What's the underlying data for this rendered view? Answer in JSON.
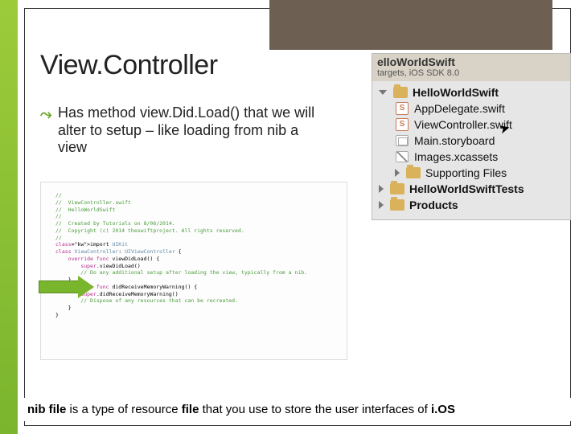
{
  "title": "View.Controller",
  "bullet": {
    "glyph": "⤳",
    "text": "Has method view.Did.Load() that we will alter to setup – like loading from nib a view"
  },
  "code": {
    "lines": [
      "//",
      "//  ViewController.swift",
      "//  HelloWorldSwift",
      "//",
      "//  Created by Tutorials on 8/06/2014.",
      "//  Copyright (c) 2014 theswiftproject. All rights reserved.",
      "//",
      "",
      "import UIKit",
      "",
      "class ViewController: UIViewController {",
      "",
      "    override func viewDidLoad() {",
      "        super.viewDidLoad()",
      "        // Do any additional setup after loading the view, typically from a nib.",
      "    }",
      "",
      "    override func didReceiveMemoryWarning() {",
      "        super.didReceiveMemoryWarning()",
      "        // Dispose of any resources that can be recreated.",
      "    }",
      "",
      "}"
    ]
  },
  "navigator": {
    "projectName": "elloWorldSwift",
    "subtitle": "targets, iOS SDK 8.0",
    "items": [
      {
        "level": 1,
        "icon": "folder",
        "label": "HelloWorldSwift",
        "expandable": true,
        "expanded": true
      },
      {
        "level": 2,
        "icon": "swift",
        "label": "AppDelegate.swift"
      },
      {
        "level": 2,
        "icon": "swift",
        "label": "ViewController.swift"
      },
      {
        "level": 2,
        "icon": "storyboard",
        "label": "Main.storyboard"
      },
      {
        "level": 2,
        "icon": "xcassets",
        "label": "Images.xcassets"
      },
      {
        "level": 2,
        "icon": "folder",
        "label": "Supporting Files",
        "expandable": true,
        "expanded": false
      },
      {
        "level": 1,
        "icon": "folder",
        "label": "HelloWorldSwiftTests",
        "expandable": true,
        "expanded": false
      },
      {
        "level": 1,
        "icon": "folder",
        "label": "Products",
        "expandable": true,
        "expanded": false
      }
    ]
  },
  "footer": {
    "bold1": "nib file",
    "mid": " is a type of resource ",
    "bold2": "file",
    "rest": " that you use to store the user interfaces of ",
    "bold3": "i.OS"
  }
}
